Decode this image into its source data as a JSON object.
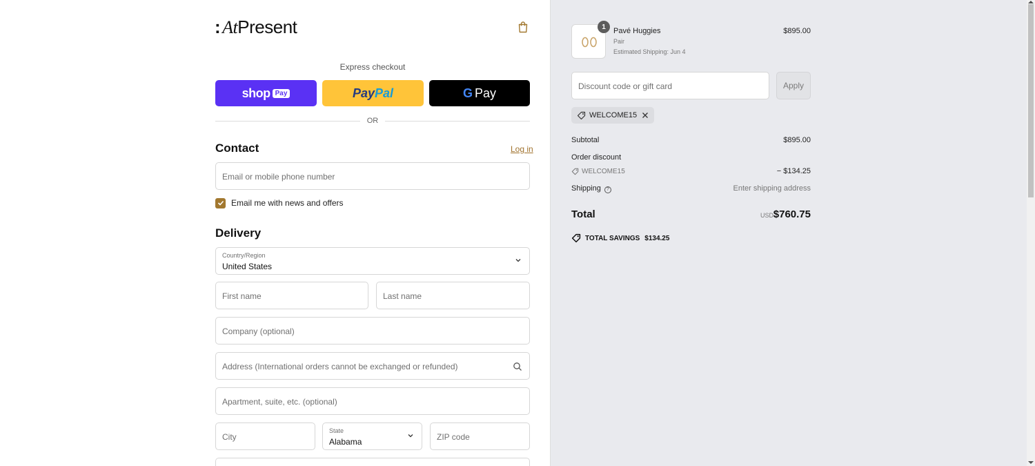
{
  "brand": {
    "logo_colon": ":",
    "logo_at": "At",
    "logo_rest": "Present"
  },
  "express": {
    "label": "Express checkout",
    "shop_text": "shop",
    "shop_pill": "Pay",
    "paypal_1": "Pay",
    "paypal_2": "Pal",
    "gpay_g": "G",
    "gpay_text": "Pay",
    "or": "OR"
  },
  "contact": {
    "title": "Contact",
    "login": "Log in",
    "email_placeholder": "Email or mobile phone number",
    "newsletter_label": "Email me with news and offers",
    "newsletter_checked": true
  },
  "delivery": {
    "title": "Delivery",
    "country_label": "Country/Region",
    "country_value": "United States",
    "first_name": "First name",
    "last_name": "Last name",
    "company": "Company (optional)",
    "address": "Address (International orders cannot be exchanged or refunded)",
    "apartment": "Apartment, suite, etc. (optional)",
    "city": "City",
    "state_label": "State",
    "state_value": "Alabama",
    "zip": "ZIP code"
  },
  "order": {
    "item": {
      "quantity": "1",
      "name": "Pavé Huggies",
      "variant": "Pair",
      "shipping_estimate": "Estimated Shipping: Jun 4",
      "price": "$895.00"
    },
    "discount_placeholder": "Discount code or gift card",
    "apply": "Apply",
    "applied_code": "WELCOME15",
    "subtotal_label": "Subtotal",
    "subtotal_value": "$895.00",
    "order_discount_label": "Order discount",
    "discount_code": "WELCOME15",
    "discount_value": "− $134.25",
    "shipping_label": "Shipping",
    "shipping_value": "Enter shipping address",
    "total_label": "Total",
    "currency": "USD",
    "total_value": "$760.75",
    "savings_label": "TOTAL SAVINGS",
    "savings_value": "$134.25"
  },
  "colors": {
    "accent": "#a2782f",
    "shop_pay": "#5a31f4",
    "paypal": "#ffc439",
    "summary_bg": "#e9eaee"
  }
}
